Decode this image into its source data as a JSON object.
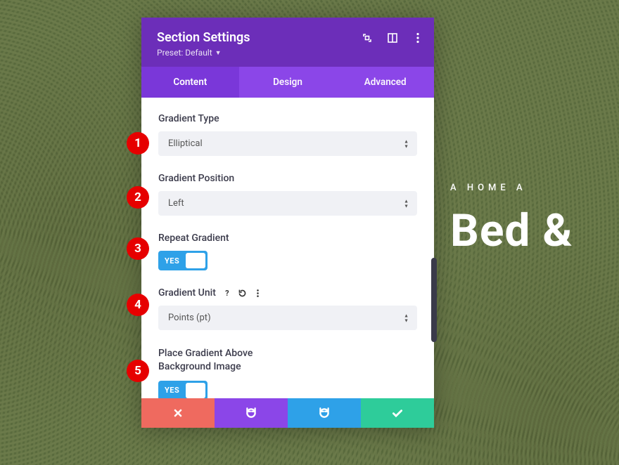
{
  "background": {
    "subheading": "A HOME A",
    "heading": "Bed &"
  },
  "panel": {
    "title": "Section Settings",
    "preset": "Preset: Default"
  },
  "tabs": {
    "content": "Content",
    "design": "Design",
    "advanced": "Advanced"
  },
  "fields": {
    "gradientType": {
      "label": "Gradient Type",
      "value": "Elliptical"
    },
    "gradientPosition": {
      "label": "Gradient Position",
      "value": "Left"
    },
    "repeatGradient": {
      "label": "Repeat Gradient",
      "toggle": "YES"
    },
    "gradientUnit": {
      "label": "Gradient Unit",
      "value": "Points (pt)"
    },
    "placeAbove": {
      "label_line1": "Place Gradient Above",
      "label_line2": "Background Image",
      "toggle": "YES"
    }
  },
  "callouts": {
    "c1": "1",
    "c2": "2",
    "c3": "3",
    "c4": "4",
    "c5": "5"
  }
}
